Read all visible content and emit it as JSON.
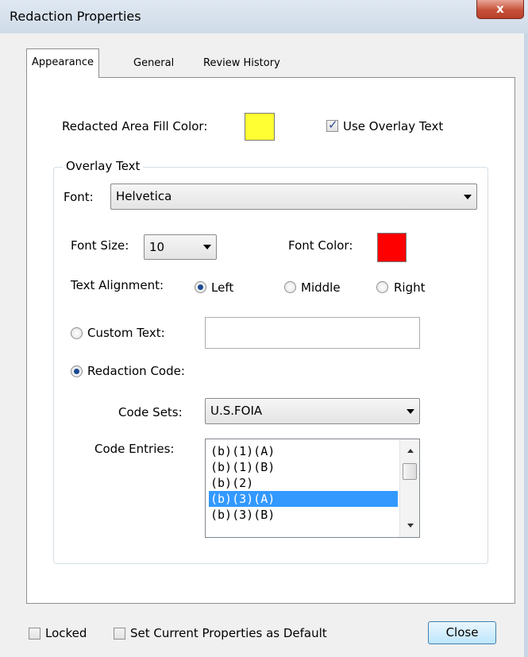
{
  "window": {
    "title": "Redaction Properties",
    "close_glyph": "x"
  },
  "tabs": [
    {
      "label": "Appearance",
      "active": true
    },
    {
      "label": "General",
      "active": false
    },
    {
      "label": "Review History",
      "active": false
    }
  ],
  "appearance": {
    "fill_color_label": "Redacted Area Fill Color:",
    "fill_color": "#ffff33",
    "use_overlay_label": "Use Overlay Text",
    "use_overlay_checked": true
  },
  "overlay": {
    "group_title": "Overlay Text",
    "font_label": "Font:",
    "font_value": "Helvetica",
    "font_size_label": "Font Size:",
    "font_size_value": "10",
    "font_color_label": "Font Color:",
    "font_color": "#ff0000",
    "alignment_label": "Text Alignment:",
    "alignment_options": [
      "Left",
      "Middle",
      "Right"
    ],
    "alignment_selected": "Left",
    "custom_text_label": "Custom Text:",
    "custom_text_value": "",
    "custom_text_selected": false,
    "redaction_code_label": "Redaction Code:",
    "redaction_code_selected": true,
    "code_sets_label": "Code Sets:",
    "code_sets_value": "U.S.FOIA",
    "code_entries_label": "Code Entries:",
    "code_entries": [
      "(b)(1)(A)",
      "(b)(1)(B)",
      "(b)(2)",
      "(b)(3)(A)",
      "(b)(3)(B)"
    ],
    "code_entries_selected": "(b)(3)(A)"
  },
  "footer": {
    "locked_label": "Locked",
    "locked_checked": false,
    "default_label": "Set Current Properties as Default",
    "default_checked": false,
    "close_label": "Close"
  },
  "colors": {
    "selection": "#3399ff",
    "accent": "#1b4a93"
  }
}
